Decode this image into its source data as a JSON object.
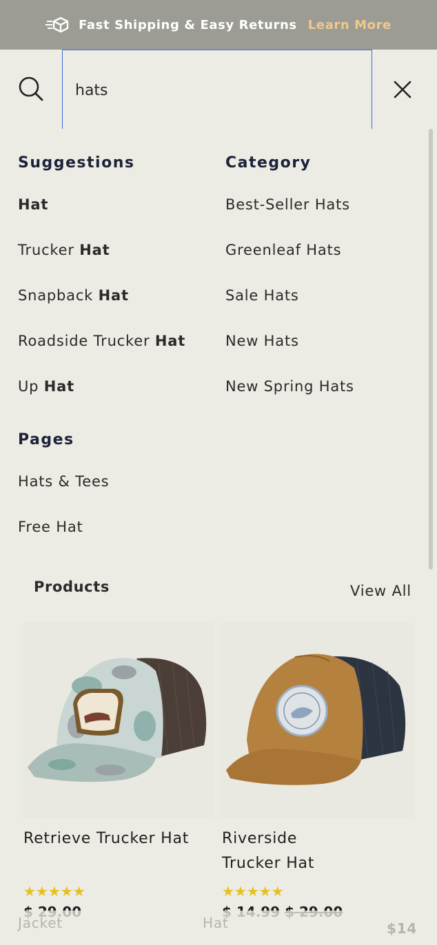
{
  "banner": {
    "text": "Fast Shipping & Easy Returns",
    "link": "Learn More"
  },
  "search": {
    "value": "hats",
    "placeholder": ""
  },
  "suggestions": {
    "heading": "Suggestions",
    "items": [
      {
        "pre": "",
        "bold": "Hat"
      },
      {
        "pre": "Trucker ",
        "bold": "Hat"
      },
      {
        "pre": "Snapback ",
        "bold": "Hat"
      },
      {
        "pre": "Roadside Trucker ",
        "bold": "Hat"
      },
      {
        "pre": "Up ",
        "bold": "Hat"
      }
    ]
  },
  "category": {
    "heading": "Category",
    "items": [
      "Best-Seller Hats",
      "Greenleaf Hats",
      "Sale Hats",
      "New Hats",
      "New Spring Hats"
    ]
  },
  "pages": {
    "heading": "Pages",
    "items": [
      "Hats & Tees",
      "Free Hat"
    ]
  },
  "products": {
    "heading": "Products",
    "view_all": "View All",
    "items": [
      {
        "name": "Retrieve Trucker Hat",
        "rating": "★★★★★",
        "price": "$ 29.00",
        "old_price": ""
      },
      {
        "name": "Riverside Trucker Hat",
        "rating": "★★★★★",
        "price": "$ 14.99",
        "old_price": "$ 29.00"
      }
    ]
  },
  "ghost_row": {
    "left": "Jacket",
    "middle": "Hat",
    "right": "$14"
  },
  "colors": {
    "background": "#ecebe4",
    "banner": "#9c9c95",
    "learn_more": "#f0c98a",
    "focus_border": "#3b6ee0",
    "star": "#e6c01d",
    "heading": "#1c2238"
  },
  "icons": {
    "banner": "shipping-box-icon",
    "search": "search-icon",
    "close": "close-icon"
  }
}
